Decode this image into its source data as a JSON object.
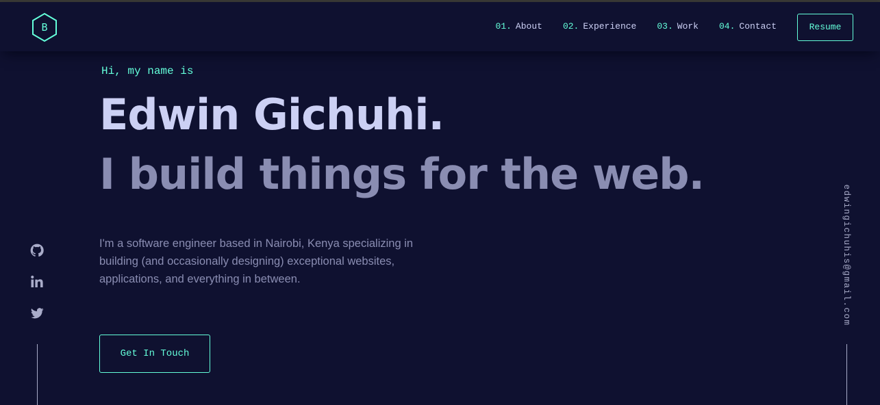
{
  "logo": {
    "letter": "B"
  },
  "nav": {
    "links": [
      {
        "num": "01.",
        "label": "About"
      },
      {
        "num": "02.",
        "label": "Experience"
      },
      {
        "num": "03.",
        "label": "Work"
      },
      {
        "num": "04.",
        "label": "Contact"
      }
    ],
    "resume_label": "Resume"
  },
  "hero": {
    "greeting": "Hi, my name is",
    "name": "Edwin Gichuhi.",
    "tagline": "I build things for the web.",
    "intro": "I'm a software engineer based in Nairobi, Kenya specializing in building (and occasionally designing) exceptional websites, applications, and everything in between.",
    "cta_label": "Get In Touch"
  },
  "social": {
    "icons": [
      "github-icon",
      "linkedin-icon",
      "twitter-icon"
    ]
  },
  "email": "edwingichuhis@gmail.com",
  "colors": {
    "background": "#0f1130",
    "accent": "#64ffda",
    "heading": "#ccd0f4",
    "muted": "#8a8db2"
  }
}
